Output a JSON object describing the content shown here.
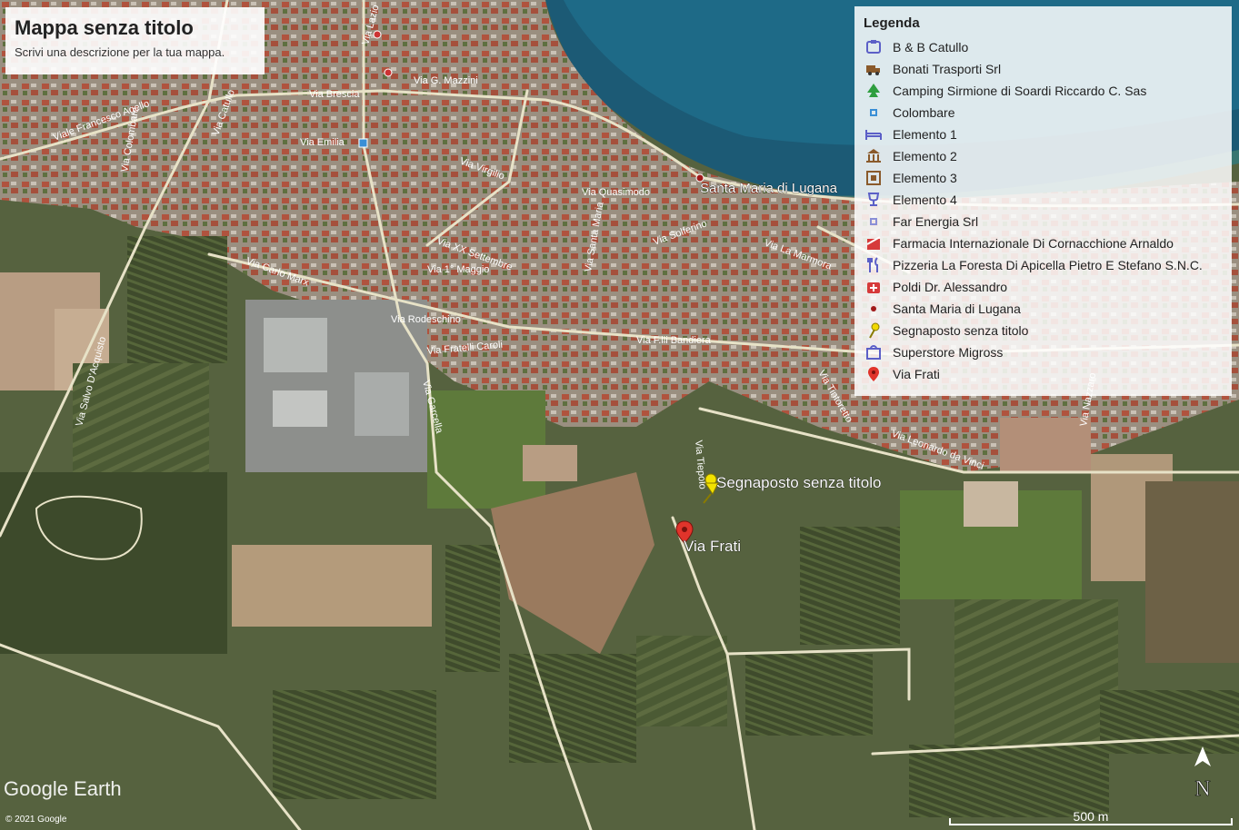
{
  "title_card": {
    "title": "Mappa senza titolo",
    "description": "Scrivi una descrizione per la tua mappa."
  },
  "legend": {
    "heading": "Legenda",
    "items": [
      {
        "label": "B & B Catullo",
        "icon": "bed-icon",
        "color": "#5b5fc7"
      },
      {
        "label": "Bonati Trasporti Srl",
        "icon": "truck-icon",
        "color": "#8a5a2b"
      },
      {
        "label": "Camping Sirmione di Soardi Riccardo C. Sas",
        "icon": "tree-icon",
        "color": "#2e9e3f"
      },
      {
        "label": "Colombare",
        "icon": "small-square-icon",
        "color": "#3a8fd6"
      },
      {
        "label": "Elemento 1",
        "icon": "bed-frame-icon",
        "color": "#5b5fc7"
      },
      {
        "label": "Elemento 2",
        "icon": "museum-icon",
        "color": "#8a5a2b"
      },
      {
        "label": "Elemento 3",
        "icon": "square-target-icon",
        "color": "#8a5a2b"
      },
      {
        "label": "Elemento 4",
        "icon": "trophy-icon",
        "color": "#5b5fc7"
      },
      {
        "label": "Far Energia Srl",
        "icon": "small-square-icon",
        "color": "#8a8fd6"
      },
      {
        "label": "Farmacia Internazionale Di Cornacchione Arnaldo",
        "icon": "pharmacy-icon",
        "color": "#d63a3a"
      },
      {
        "label": "Pizzeria La Foresta Di Apicella Pietro E Stefano S.N.C.",
        "icon": "fork-knife-icon",
        "color": "#5b5fc7"
      },
      {
        "label": "Poldi Dr. Alessandro",
        "icon": "first-aid-icon",
        "color": "#d63a3a"
      },
      {
        "label": "Santa Maria di Lugana",
        "icon": "dot-icon",
        "color": "#a11a1a"
      },
      {
        "label": "Segnaposto senza titolo",
        "icon": "yellow-pushpin-icon",
        "color": "#f2d800"
      },
      {
        "label": "Superstore Migross",
        "icon": "shopping-bag-icon",
        "color": "#5b5fc7"
      },
      {
        "label": "Via Frati",
        "icon": "red-pin-icon",
        "color": "#e0342b"
      }
    ]
  },
  "map_labels": {
    "santa_maria": "Santa Maria di Lugana",
    "segnaposto": "Segnaposto senza titolo",
    "via_frati": "Via Frati"
  },
  "road_labels": [
    "Via Lazio",
    "Via Brescia",
    "Via G. Mazzini",
    "Viale Francesco Agello",
    "Via Colombare",
    "Via Virgilio",
    "Via Quasimodo",
    "Via Emilia",
    "Via Catullo",
    "Via Santa Maria",
    "Via Solferino",
    "Via La Marmora",
    "Via XX Settembre",
    "Via 1° Maggio",
    "Via Carlo Marx",
    "Via Rodeschino",
    "Via Fratelli Caroli",
    "Via F.lli Bandiera",
    "Via Garcella",
    "Via Salvo D'Acquisto",
    "Via Tintoretto",
    "Via Leonardo da Vinci",
    "Via Nazzaro",
    "Via Tiepolo"
  ],
  "branding": {
    "watermark": "Google Earth",
    "copyright": "© 2021 Google"
  },
  "scale": {
    "label": "500 m"
  },
  "compass": {
    "label": "N"
  }
}
